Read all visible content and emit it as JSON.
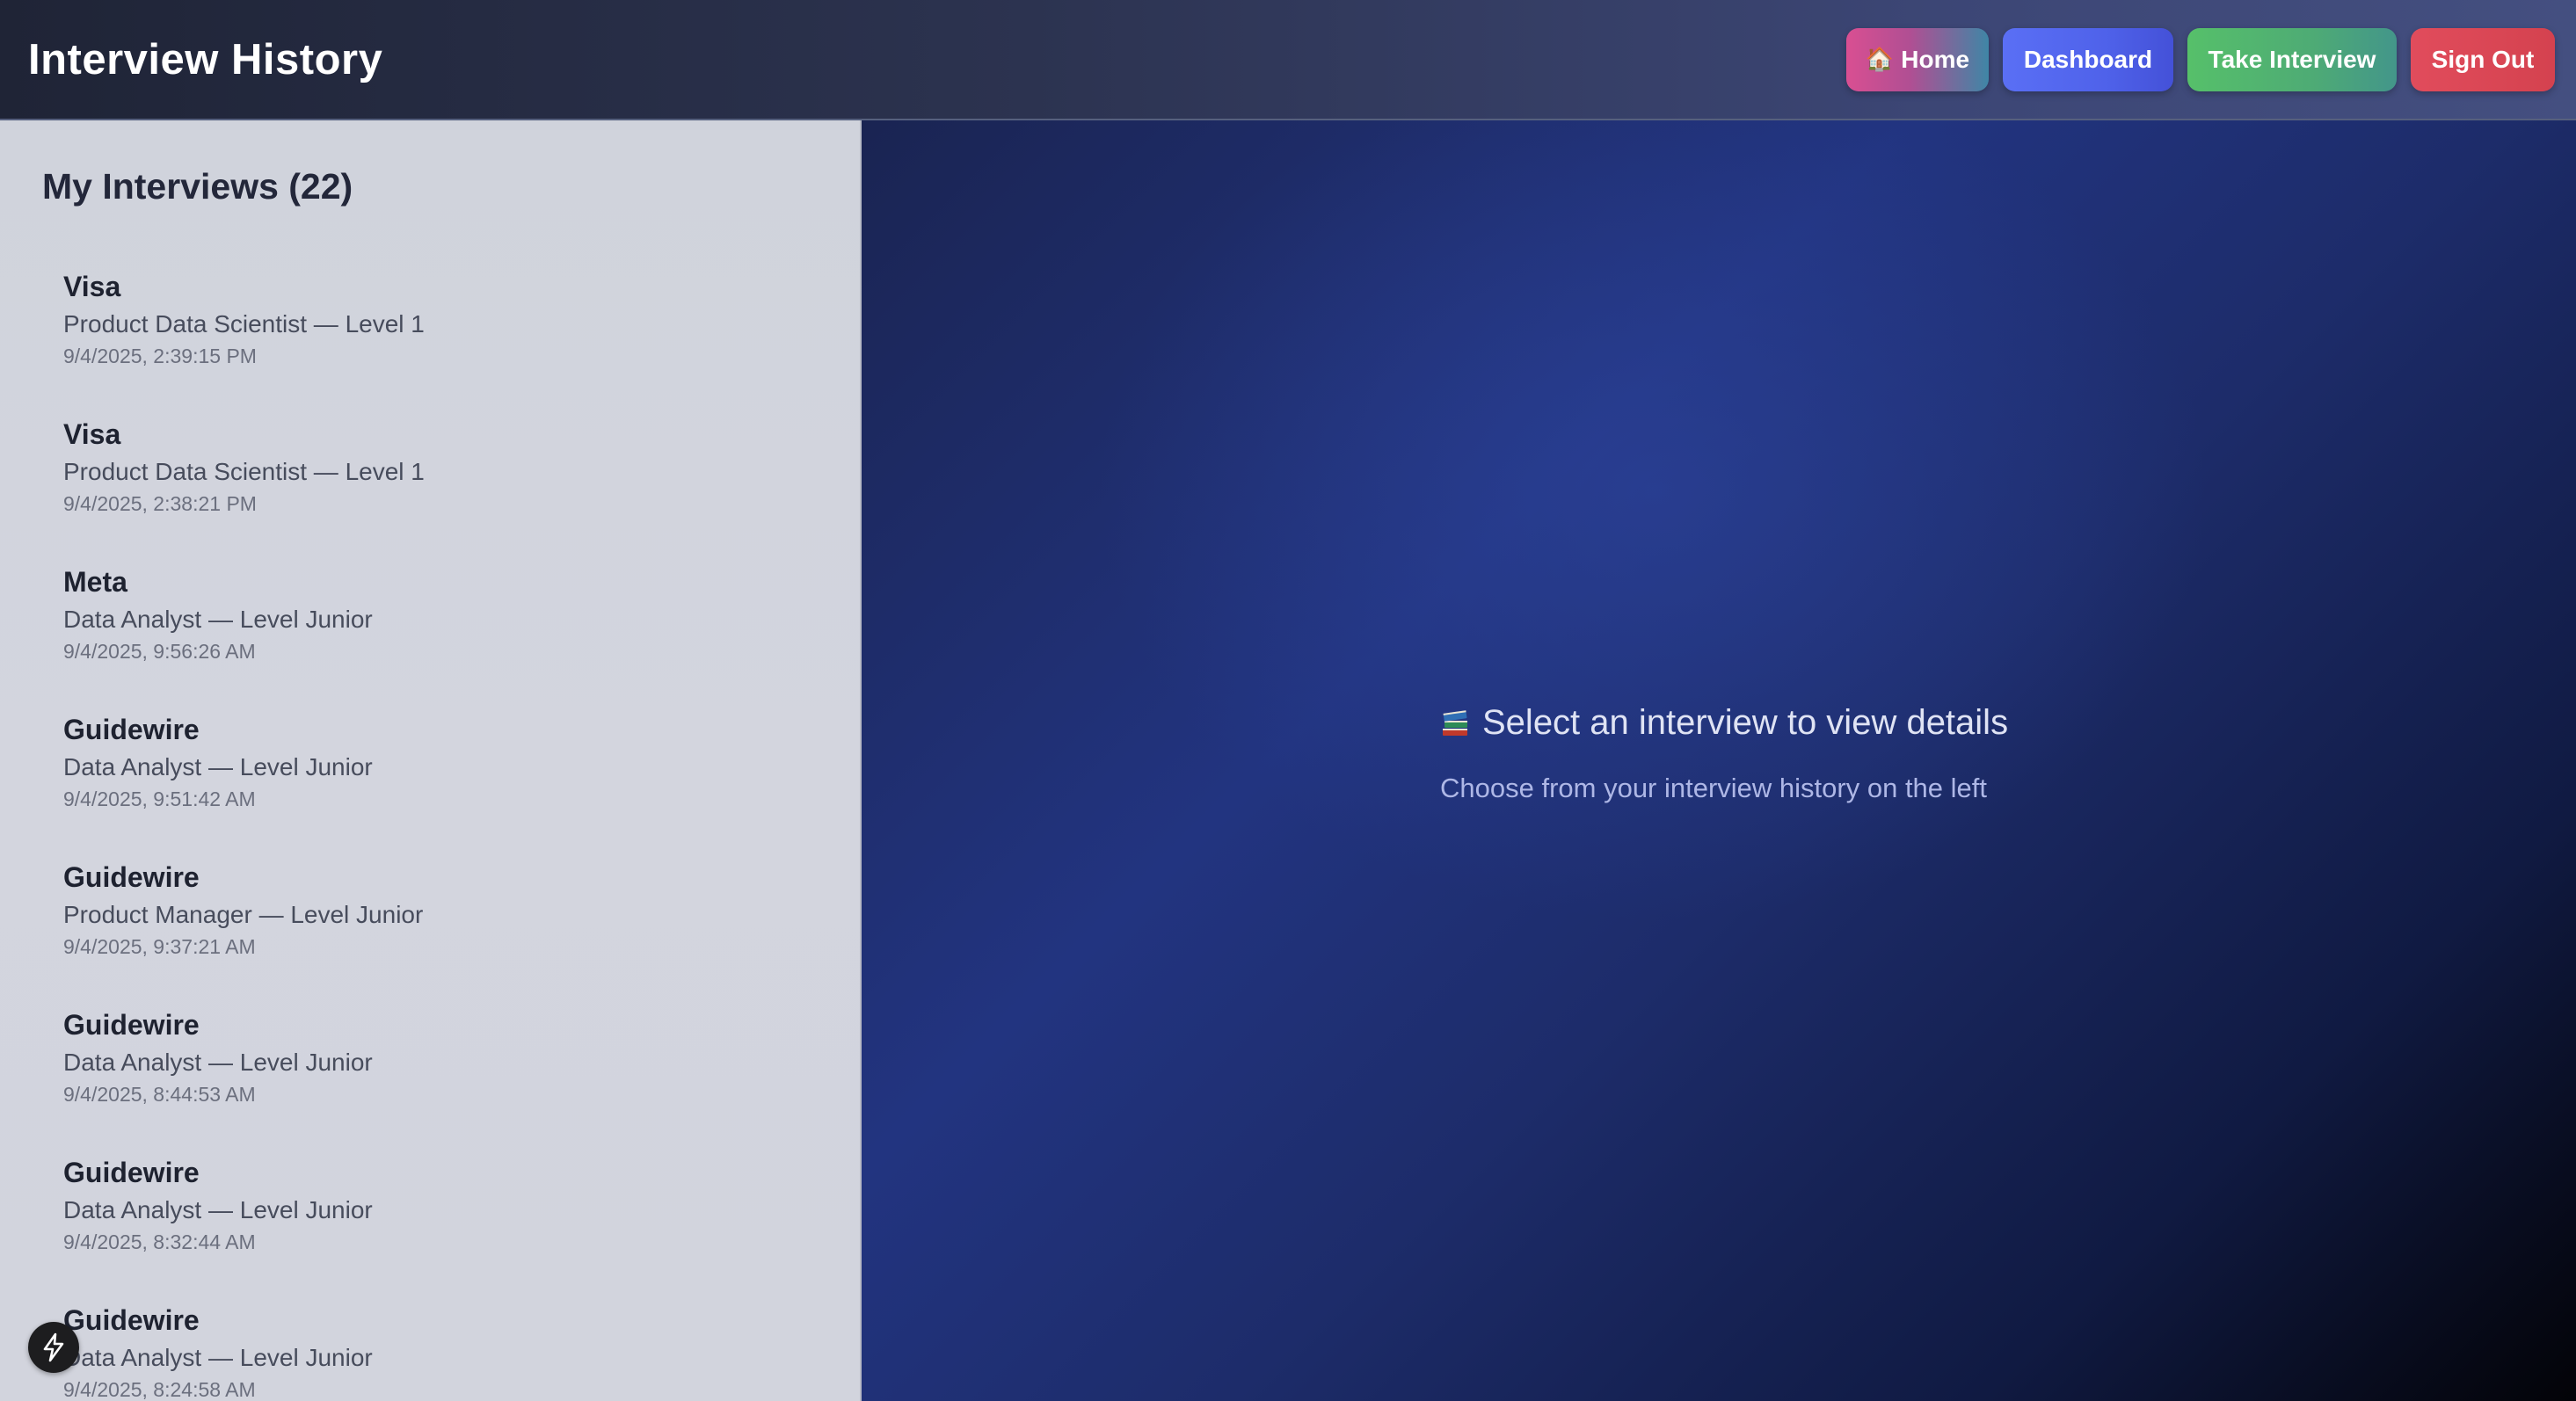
{
  "header": {
    "title": "Interview History",
    "nav": {
      "home_label": "Home",
      "dashboard_label": "Dashboard",
      "take_interview_label": "Take Interview",
      "sign_out_label": "Sign Out"
    }
  },
  "sidebar": {
    "heading": "My Interviews (22)",
    "items": [
      {
        "company": "Visa",
        "role": "Product Data Scientist — Level 1",
        "date": "9/4/2025, 2:39:15 PM"
      },
      {
        "company": "Visa",
        "role": "Product Data Scientist — Level 1",
        "date": "9/4/2025, 2:38:21 PM"
      },
      {
        "company": "Meta",
        "role": "Data Analyst — Level Junior",
        "date": "9/4/2025, 9:56:26 AM"
      },
      {
        "company": "Guidewire",
        "role": "Data Analyst — Level Junior",
        "date": "9/4/2025, 9:51:42 AM"
      },
      {
        "company": "Guidewire",
        "role": "Product Manager — Level Junior",
        "date": "9/4/2025, 9:37:21 AM"
      },
      {
        "company": "Guidewire",
        "role": "Data Analyst — Level Junior",
        "date": "9/4/2025, 8:44:53 AM"
      },
      {
        "company": "Guidewire",
        "role": "Data Analyst — Level Junior",
        "date": "9/4/2025, 8:32:44 AM"
      },
      {
        "company": "Guidewire",
        "role": "Data Analyst — Level Junior",
        "date": "9/4/2025, 8:24:58 AM"
      }
    ]
  },
  "main": {
    "empty_title": "Select an interview to view details",
    "empty_subtitle": "Choose from your interview history on the left"
  },
  "icons": {
    "home": "home-icon",
    "books": "books-icon",
    "bolt": "lightning-bolt-icon"
  }
}
